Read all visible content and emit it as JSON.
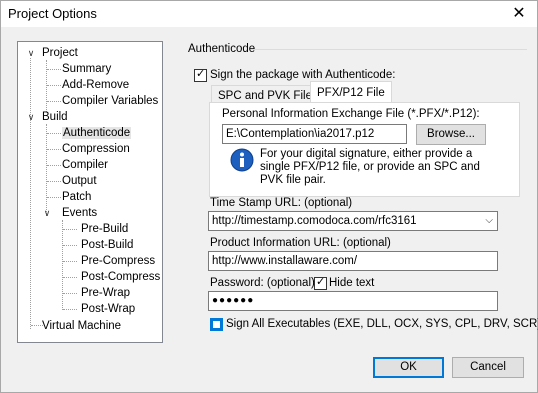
{
  "window": {
    "title": "Project Options",
    "close_glyph": "✕"
  },
  "tree": {
    "items": [
      {
        "label": "Project",
        "caret": "∨"
      },
      {
        "label": "Summary"
      },
      {
        "label": "Add-Remove"
      },
      {
        "label": "Compiler Variables"
      },
      {
        "label": "Build",
        "caret": "∨"
      },
      {
        "label": "Authenticode",
        "selected": true
      },
      {
        "label": "Compression"
      },
      {
        "label": "Compiler"
      },
      {
        "label": "Output"
      },
      {
        "label": "Patch"
      },
      {
        "label": "Events",
        "caret": "∨"
      },
      {
        "label": "Pre-Build"
      },
      {
        "label": "Post-Build"
      },
      {
        "label": "Pre-Compress"
      },
      {
        "label": "Post-Compress"
      },
      {
        "label": "Pre-Wrap"
      },
      {
        "label": "Post-Wrap"
      },
      {
        "label": "Virtual Machine"
      }
    ]
  },
  "authenticode": {
    "group_label": "Authenticode",
    "sign_checkbox_label": "Sign the package with Authenticode:",
    "sign_checked": true,
    "tabs": [
      {
        "label": "SPC and PVK Files",
        "active": false
      },
      {
        "label": "PFX/P12 File",
        "active": true
      }
    ],
    "pfx_label": "Personal Information Exchange File (*.PFX/*.P12):",
    "pfx_path": "E:\\Contemplation\\ia2017.p12",
    "browse_label": "Browse...",
    "info_text": "For your digital signature, either provide a single PFX/P12 file, or provide an SPC and PVK file pair.",
    "info_icon": "info-icon",
    "timestamp_label": "Time Stamp URL: (optional)",
    "timestamp_value": "http://timestamp.comodoca.com/rfc3161",
    "product_url_label": "Product Information URL: (optional)",
    "product_url_value": "http://www.installaware.com/",
    "password_label": "Password: (optional)",
    "hide_text_label": "Hide text",
    "hide_text_checked": true,
    "password_mask": "●●●●●●",
    "sign_all_label": "Sign All Executables (EXE, DLL, OCX, SYS, CPL, DRV, SCR)",
    "sign_all_checked": true
  },
  "footer": {
    "ok_label": "OK",
    "cancel_label": "Cancel"
  },
  "colors": {
    "accent": "#0078d7",
    "info_blue": "#1c5fbf"
  }
}
